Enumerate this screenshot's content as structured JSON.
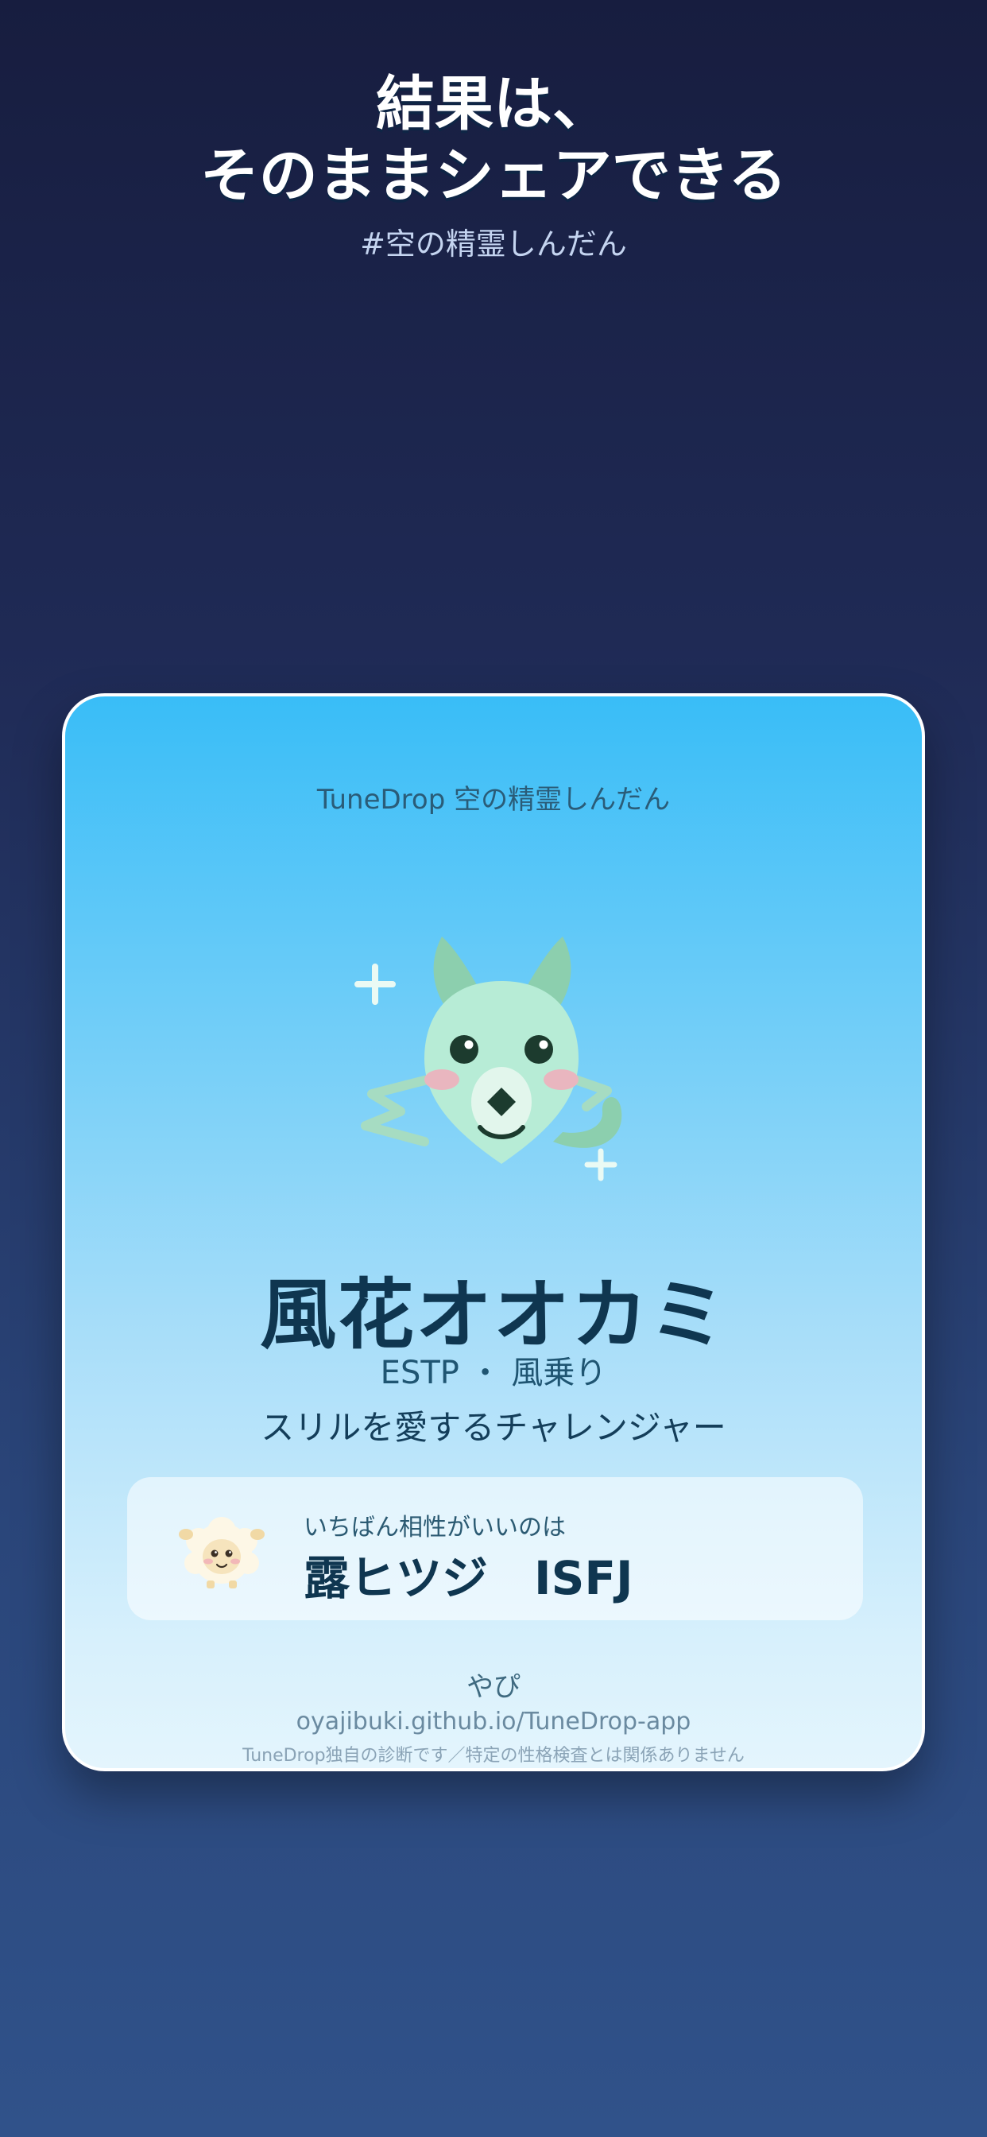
{
  "headline": {
    "line1": "結果は、",
    "line2": "そのままシェアできる"
  },
  "hashtag": "#空の精霊しんだん",
  "card": {
    "header": "TuneDrop 空の精霊しんだん",
    "mascot_icon": "wind-wolf-spirit-icon",
    "type_name": "風花オオカミ",
    "type_code": "ESTP ・ 風乗り",
    "tagline": "スリルを愛するチャレンジャー",
    "match": {
      "label": "いちばん相性がいいのは",
      "avatar_icon": "dew-sheep-icon",
      "name": "露ヒツジ　ISFJ"
    },
    "author": "やぴ",
    "url": "oyajibuki.github.io/TuneDrop-app",
    "disclaimer": "TuneDrop独自の診断です／特定の性格検査とは関係ありません"
  },
  "colors": {
    "background_top": "#171d3f",
    "background_bottom": "#30528a",
    "card_top": "#39bdf7",
    "card_bottom": "#e4f5fd",
    "type_name": "#0f3650",
    "mascot_body": "#b7ecd6",
    "mascot_ears": "#8ccfae"
  }
}
